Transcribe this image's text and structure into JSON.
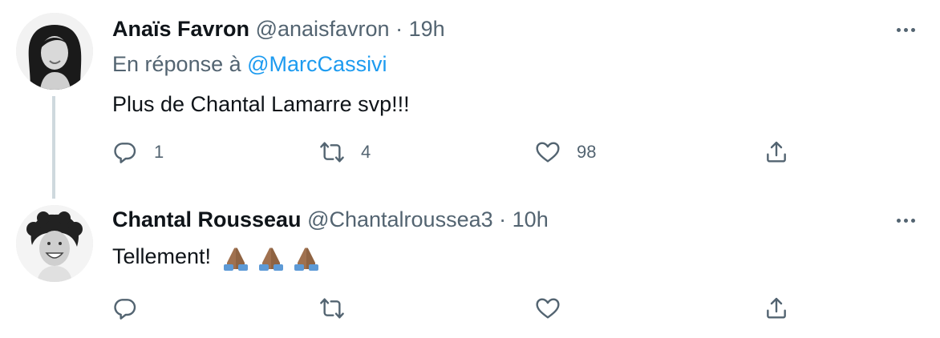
{
  "tweets": [
    {
      "name": "Anaïs Favron",
      "handle": "@anaisfavron",
      "separator": "·",
      "time": "19h",
      "reply_prefix": "En réponse à",
      "reply_mention": "@MarcCassivi",
      "text": "Plus de Chantal Lamarre svp!!!",
      "counts": {
        "reply": "1",
        "retweet": "4",
        "like": "98"
      }
    },
    {
      "name": "Chantal Rousseau",
      "handle": "@Chantalroussea3",
      "separator": "·",
      "time": "10h",
      "text": "Tellement!",
      "emojis": [
        "folded-hands",
        "folded-hands",
        "folded-hands"
      ]
    }
  ],
  "icons": {
    "reply": "reply-icon",
    "retweet": "retweet-icon",
    "like": "heart-icon",
    "share": "share-icon",
    "more": "more-icon"
  },
  "colors": {
    "text": "#0f1419",
    "secondary": "#536471",
    "accent": "#1d9bf0",
    "thread_line": "#cfd9de"
  }
}
